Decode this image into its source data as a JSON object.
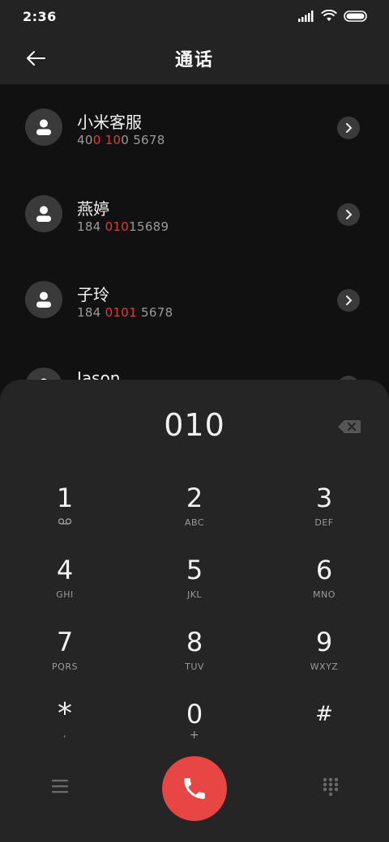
{
  "status": {
    "time": "2:36"
  },
  "header": {
    "title": "通话"
  },
  "contacts": [
    {
      "name": "小米客服",
      "number_parts": [
        [
          "40",
          false
        ],
        [
          "0",
          true
        ],
        [
          " ",
          false
        ],
        [
          "10",
          true
        ],
        [
          "0 5678",
          false
        ]
      ]
    },
    {
      "name": "燕婷",
      "number_parts": [
        [
          "184 ",
          false
        ],
        [
          "010",
          true
        ],
        [
          "15689",
          false
        ]
      ]
    },
    {
      "name": "子玲",
      "number_parts": [
        [
          "184 ",
          false
        ],
        [
          "0101",
          true
        ],
        [
          " 5678",
          false
        ]
      ]
    },
    {
      "name": "Jason",
      "number_parts": []
    }
  ],
  "dialer": {
    "input_value": "010"
  },
  "keys": [
    {
      "digit": "1",
      "letters": ""
    },
    {
      "digit": "2",
      "letters": "ABC"
    },
    {
      "digit": "3",
      "letters": "DEF"
    },
    {
      "digit": "4",
      "letters": "GHI"
    },
    {
      "digit": "5",
      "letters": "JKL"
    },
    {
      "digit": "6",
      "letters": "MNO"
    },
    {
      "digit": "7",
      "letters": "PQRS"
    },
    {
      "digit": "8",
      "letters": "TUV"
    },
    {
      "digit": "9",
      "letters": "WXYZ"
    },
    {
      "digit": "*",
      "letters": ","
    },
    {
      "digit": "0",
      "letters": "+"
    },
    {
      "digit": "#",
      "letters": ""
    }
  ],
  "colors": {
    "accent_red": "#e84545",
    "highlight_red": "#e53935"
  }
}
